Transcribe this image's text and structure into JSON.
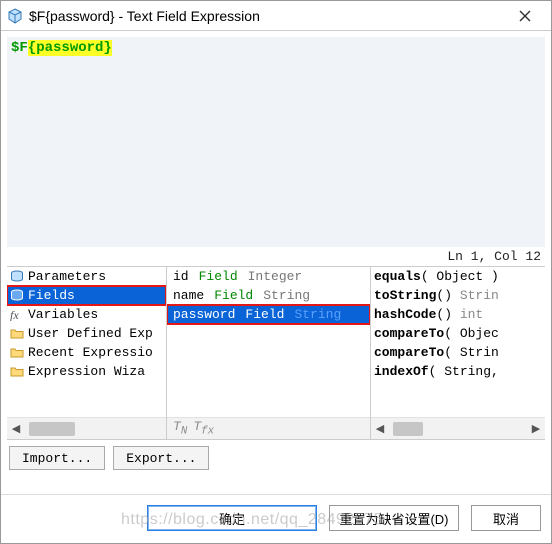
{
  "titlebar": {
    "title": "$F{password} - Text Field Expression"
  },
  "editor": {
    "prefix": "$F",
    "variable": "{password}"
  },
  "status": {
    "text": "Ln 1, Col 12"
  },
  "tree": {
    "items": [
      {
        "label": "Parameters",
        "icon": "db-icon"
      },
      {
        "label": "Fields",
        "icon": "db-icon",
        "selected": true,
        "boxed": true
      },
      {
        "label": "Variables",
        "icon": "fx-icon"
      },
      {
        "label": "User Defined Exp",
        "icon": "folder-icon"
      },
      {
        "label": "Recent Expressio",
        "icon": "folder-icon"
      },
      {
        "label": "Expression Wiza",
        "icon": "folder-icon"
      }
    ]
  },
  "fields": {
    "rows": [
      {
        "name": "id",
        "kw": "Field",
        "type": "Integer"
      },
      {
        "name": "name",
        "kw": "Field",
        "type": "String"
      },
      {
        "name": "password",
        "kw": "Field",
        "type": "String",
        "selected": true,
        "boxed": true
      }
    ]
  },
  "methods": {
    "rows": [
      {
        "name": "equals",
        "sig": "( Object )",
        "ret": ""
      },
      {
        "name": "toString",
        "sig": "()",
        "ret": " Strin"
      },
      {
        "name": "hashCode",
        "sig": "()",
        "ret": " int"
      },
      {
        "name": "compareTo",
        "sig": "( Objec",
        "ret": ""
      },
      {
        "name": "compareTo",
        "sig": "( Strin",
        "ret": ""
      },
      {
        "name": "indexOf",
        "sig": "( String,",
        "ret": ""
      }
    ]
  },
  "buttons": {
    "import": "Import...",
    "export": "Export...",
    "ok": "确定",
    "reset": "重置为缺省设置(D)",
    "cancel": "取消"
  },
  "watermark": "https://blog.csdn.net/qq_28492575"
}
